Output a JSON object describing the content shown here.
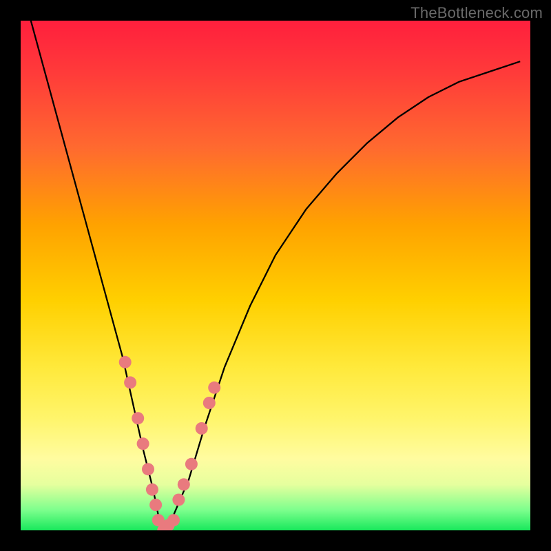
{
  "watermark": "TheBottleneck.com",
  "chart_data": {
    "type": "line",
    "title": "",
    "xlabel": "",
    "ylabel": "",
    "xlim": [
      0,
      100
    ],
    "ylim": [
      0,
      100
    ],
    "grid": false,
    "legend": false,
    "series": [
      {
        "name": "bottleneck-curve",
        "x": [
          2,
          5,
          8,
          11,
          14,
          17,
          20,
          22,
          24,
          26,
          27,
          28,
          30,
          33,
          36,
          40,
          45,
          50,
          56,
          62,
          68,
          74,
          80,
          86,
          92,
          98
        ],
        "y": [
          100,
          89,
          78,
          67,
          56,
          45,
          34,
          25,
          16,
          8,
          3,
          0,
          3,
          10,
          20,
          32,
          44,
          54,
          63,
          70,
          76,
          81,
          85,
          88,
          90,
          92
        ]
      }
    ],
    "markers": [
      {
        "name": "highlight-points-left",
        "color": "#e97a7e",
        "points": [
          {
            "x": 20.5,
            "y": 33
          },
          {
            "x": 21.5,
            "y": 29
          },
          {
            "x": 23.0,
            "y": 22
          },
          {
            "x": 24.0,
            "y": 17
          },
          {
            "x": 25.0,
            "y": 12
          },
          {
            "x": 25.8,
            "y": 8
          },
          {
            "x": 26.5,
            "y": 5
          }
        ]
      },
      {
        "name": "highlight-points-bottom",
        "color": "#e97a7e",
        "points": [
          {
            "x": 27.0,
            "y": 2
          },
          {
            "x": 28.0,
            "y": 0
          },
          {
            "x": 29.0,
            "y": 1
          },
          {
            "x": 30.0,
            "y": 2
          }
        ]
      },
      {
        "name": "highlight-points-right",
        "color": "#e97a7e",
        "points": [
          {
            "x": 31.0,
            "y": 6
          },
          {
            "x": 32.0,
            "y": 9
          },
          {
            "x": 33.5,
            "y": 13
          },
          {
            "x": 35.5,
            "y": 20
          },
          {
            "x": 37.0,
            "y": 25
          },
          {
            "x": 38.0,
            "y": 28
          }
        ]
      }
    ],
    "marker_radius": 9,
    "colors": {
      "curve": "#000000",
      "marker": "#e97a7e"
    }
  }
}
